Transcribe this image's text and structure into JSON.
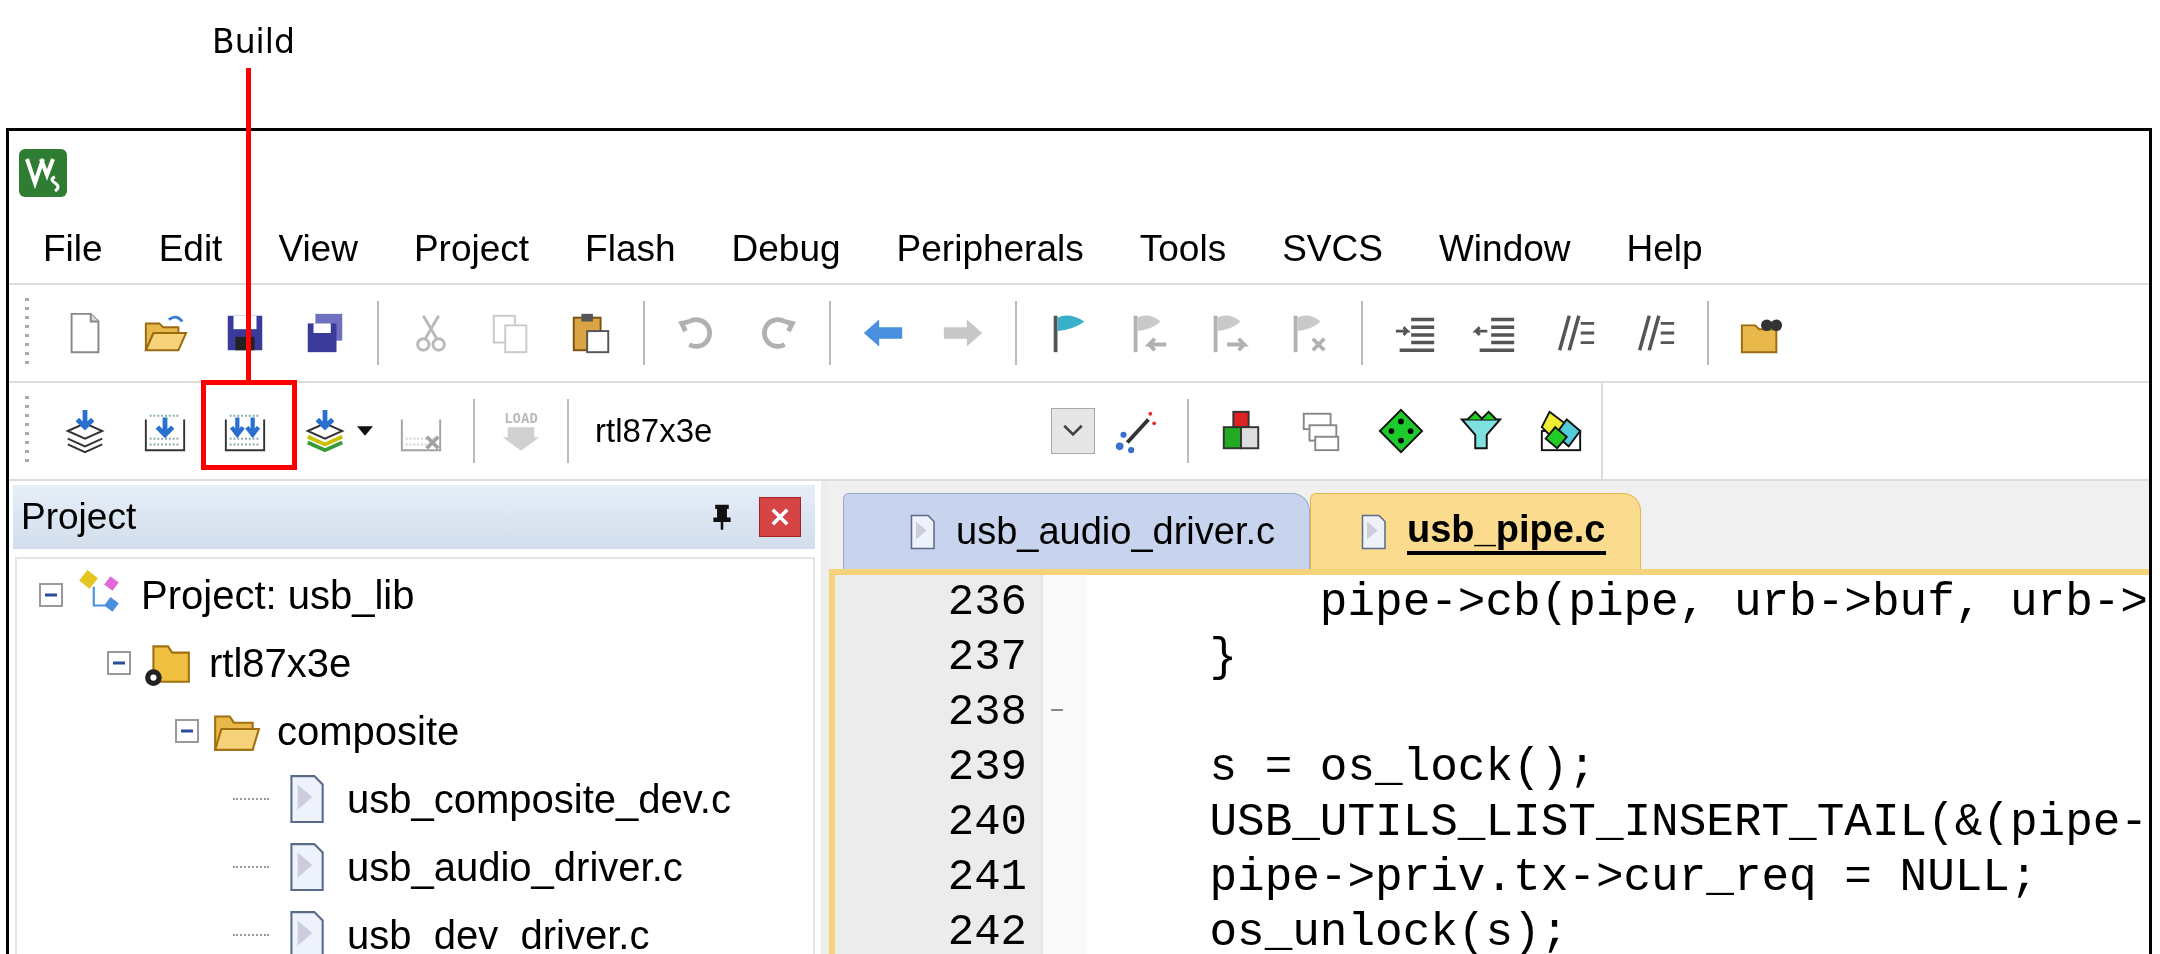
{
  "annotation": {
    "label": "Build"
  },
  "menu": [
    "File",
    "Edit",
    "View",
    "Project",
    "Flash",
    "Debug",
    "Peripherals",
    "Tools",
    "SVCS",
    "Window",
    "Help"
  ],
  "toolbar_1": {
    "buttons": [
      {
        "disabled": false
      },
      {
        "disabled": false
      },
      {
        "disabled": false
      },
      {
        "disabled": false
      },
      {
        "disabled": true
      },
      {
        "disabled": true
      },
      {
        "disabled": false
      },
      {
        "disabled": true
      },
      {
        "disabled": true
      },
      {
        "disabled": false
      },
      {
        "disabled": true
      },
      {
        "disabled": false
      },
      {
        "disabled": true
      },
      {
        "disabled": true
      },
      {
        "disabled": true
      },
      {
        "disabled": false
      },
      {
        "disabled": false
      },
      {
        "disabled": false
      },
      {
        "disabled": false
      },
      {
        "disabled": false
      }
    ]
  },
  "toolbar_2": {
    "buttons": [
      {
        "disabled": false
      },
      {
        "disabled": false
      },
      {
        "disabled": false
      },
      {
        "disabled": false
      },
      {
        "disabled": true
      },
      {
        "disabled": true,
        "caption": "LOAD"
      }
    ],
    "target": {
      "value": "rtl87x3e"
    },
    "tools": [
      {
        "disabled": false
      },
      {
        "disabled": false
      },
      {
        "disabled": false
      },
      {
        "disabled": false
      },
      {
        "disabled": false
      },
      {
        "disabled": false
      }
    ]
  },
  "project_panel": {
    "title": "Project",
    "tree": [
      {
        "kind": "project",
        "label": "Project: usb_lib",
        "expanded": true,
        "children": [
          {
            "kind": "target",
            "label": "rtl87x3e",
            "expanded": true,
            "children": [
              {
                "kind": "folder",
                "label": "composite",
                "expanded": true,
                "children": [
                  {
                    "kind": "file",
                    "label": "usb_composite_dev.c"
                  },
                  {
                    "kind": "file",
                    "label": "usb_audio_driver.c"
                  },
                  {
                    "kind": "file",
                    "label": "usb_dev_driver.c"
                  }
                ]
              }
            ]
          }
        ]
      }
    ]
  },
  "editor": {
    "tabs": [
      {
        "label": "usb_audio_driver.c",
        "selected": false
      },
      {
        "label": "usb_pipe.c",
        "selected": true
      }
    ],
    "lines": [
      {
        "number": "236",
        "text": "        pipe->cb(pipe, urb->buf, urb->"
      },
      {
        "number": "237",
        "text": "    }"
      },
      {
        "number": "238",
        "fold_end": true
      },
      {
        "number": "239",
        "text": "    s = os_lock();"
      },
      {
        "number": "240",
        "text": "    USB_UTILS_LIST_INSERT_TAIL(&(pipe-"
      },
      {
        "number": "241",
        "text": "    pipe->priv.tx->cur_req = NULL;"
      },
      {
        "number": "242",
        "text": "    os_unlock(s);"
      }
    ]
  }
}
